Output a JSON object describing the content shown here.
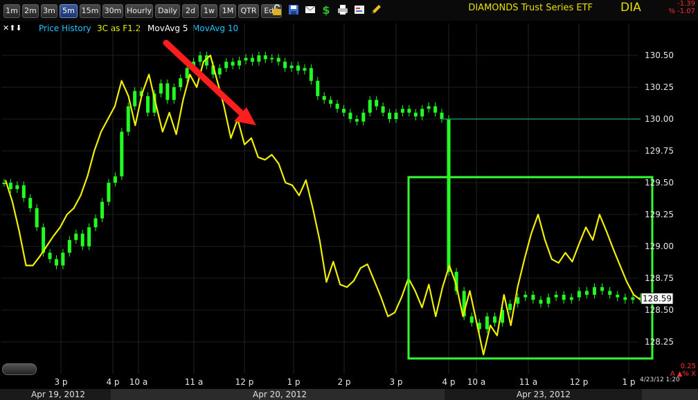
{
  "toolbar": {
    "timeframes": [
      "1m",
      "2m",
      "3m",
      "5m",
      "15m",
      "30m",
      "Hourly",
      "Daily",
      "2d",
      "1w",
      "1M",
      "QTR",
      "Edit"
    ],
    "active_timeframe": "5m",
    "icons": [
      "lock-icon",
      "save-icon",
      "mail-icon",
      "dollar-icon",
      "print-icon",
      "settings-icon",
      "pencil-icon"
    ]
  },
  "header": {
    "title": "DIAMONDS Trust Series ETF",
    "symbol": "DIA",
    "change": "-1.39",
    "change_pct": "% -1.07"
  },
  "legend": {
    "arrows": "✕⬆⬇",
    "items": [
      {
        "label": "Price History",
        "color": "#22c6ff"
      },
      {
        "label": "3C as F1.2",
        "color": "#f0f000"
      },
      {
        "label": "MovAvg 5",
        "color": "#ffffff"
      },
      {
        "label": "MovAvg 10",
        "color": "#22c6ff"
      }
    ]
  },
  "colors": {
    "price": "#22ff22",
    "indicator": "#f0f000",
    "box": "#33ff33",
    "arrow": "#ff1e1e",
    "price_label_bg": "#ffffff",
    "background": "#000000"
  },
  "footer": {
    "dates": [
      "Apr 19, 2012",
      "Apr 20, 2012",
      "Apr 23, 2012"
    ],
    "timestamp": "4/23/12 1:20",
    "right_label": "0.25",
    "right_icons": "A ▲% X"
  },
  "chart_data": {
    "type": "line",
    "x_ticks": [
      "3 p",
      "4 p",
      "10 a",
      "11 a",
      "12 p",
      "1 p",
      "2 p",
      "3 p",
      "4 p",
      "10 a",
      "11 a",
      "12 p",
      "1 p"
    ],
    "yaxis_ticks": [
      "130.50",
      "130.25",
      "130.00",
      "129.75",
      "129.50",
      "129.25",
      "129.00",
      "128.75",
      "128.50",
      "128.25"
    ],
    "ylim": [
      128.0,
      130.75
    ],
    "last_price": 128.59,
    "last_price_label": "128.59",
    "projection_line": 130.0,
    "series": [
      {
        "name": "3C as F1.2",
        "style": "line",
        "values": [
          129.52,
          129.35,
          129.12,
          128.85,
          128.85,
          128.92,
          129.0,
          129.08,
          129.15,
          129.25,
          129.3,
          129.4,
          129.55,
          129.75,
          129.9,
          130.0,
          130.1,
          130.3,
          130.18,
          129.95,
          130.2,
          130.35,
          130.12,
          129.9,
          130.05,
          129.88,
          130.15,
          130.35,
          130.25,
          130.45,
          130.5,
          130.3,
          130.1,
          129.85,
          130.0,
          129.8,
          129.85,
          129.7,
          129.68,
          129.72,
          129.65,
          129.5,
          129.48,
          129.4,
          129.52,
          129.3,
          129.05,
          128.72,
          128.88,
          128.7,
          128.68,
          128.73,
          128.83,
          128.86,
          128.73,
          128.6,
          128.45,
          128.48,
          128.6,
          128.75,
          128.65,
          128.52,
          128.7,
          128.45,
          128.68,
          128.85,
          128.7,
          128.45,
          128.65,
          128.4,
          128.15,
          128.38,
          128.3,
          128.62,
          128.38,
          128.68,
          128.9,
          129.1,
          129.25,
          129.05,
          128.9,
          128.87,
          128.95,
          128.88,
          129.02,
          129.15,
          129.05,
          129.25,
          129.12,
          128.98,
          128.85,
          128.72,
          128.62,
          128.58
        ]
      },
      {
        "name": "Price History",
        "style": "candles",
        "values": [
          129.5,
          129.45,
          129.48,
          129.38,
          129.3,
          129.15,
          128.95,
          128.9,
          128.85,
          128.95,
          129.05,
          129.1,
          129.0,
          129.15,
          129.22,
          129.35,
          129.5,
          129.55,
          129.9,
          130.1,
          130.22,
          130.18,
          130.05,
          130.2,
          130.28,
          130.15,
          130.25,
          130.32,
          130.4,
          130.45,
          130.5,
          130.42,
          130.35,
          130.4,
          130.45,
          130.42,
          130.46,
          130.48,
          130.45,
          130.5,
          130.47,
          130.48,
          130.45,
          130.4,
          130.42,
          130.38,
          130.4,
          130.3,
          130.18,
          130.15,
          130.12,
          130.08,
          130.05,
          130.0,
          129.98,
          130.05,
          130.15,
          130.1,
          130.05,
          130.0,
          130.05,
          130.08,
          130.05,
          130.02,
          130.08,
          130.1,
          130.05,
          130.0,
          128.8,
          128.65,
          128.45,
          128.4,
          128.35,
          128.45,
          128.4,
          128.5,
          128.55,
          128.6,
          128.62,
          128.58,
          128.55,
          128.6,
          128.62,
          128.58,
          128.6,
          128.65,
          128.62,
          128.68,
          128.65,
          128.62,
          128.6,
          128.58,
          128.6,
          128.59
        ]
      }
    ]
  }
}
